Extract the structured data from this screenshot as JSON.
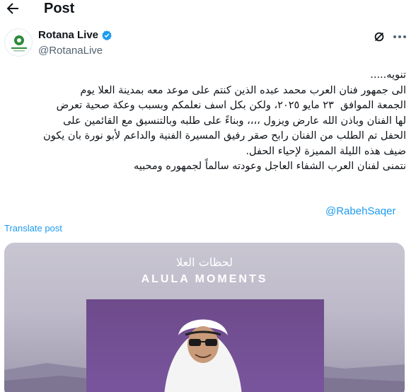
{
  "header": {
    "title": "Post"
  },
  "author": {
    "display_name": "Rotana Live",
    "handle": "@RotanaLive"
  },
  "tweet": {
    "lines": [
      "تنويه.....",
      "الى جمهور فنان العرب محمد عبده الذين كنتم على موعد معه بمدينة العلا يوم",
      "الجمعة الموافق  ٢٣ مايو ٢٠٢٥، ولكن بكل اسف نعلمكم وبسبب وعكة صحية تعرض",
      "لها الفنان وباذن الله عارض ويزول ،،،، وبناءً على طلبه وبالتنسيق مع القائمين على",
      "الحفل تم الطلب من الفنان رابح صقر رفيق المسيرة الفنية والداعم لأبو نورة بان يكون",
      "ضيف هذه الليلة المميزة لإحياء الحفل.",
      "نتمنى لفنان العرب الشفاء العاجل وعودته سالماً لجمهوره ومحبيه"
    ],
    "mention": "@RabehSaqer",
    "translate_label": "Translate post"
  },
  "media": {
    "arabic_title": "لحظات العلا",
    "title": "ALULA MOMENTS"
  },
  "colors": {
    "link": "#1d9bf0",
    "verified": "#1d9bf0",
    "text": "#0f1419",
    "muted": "#536471"
  }
}
